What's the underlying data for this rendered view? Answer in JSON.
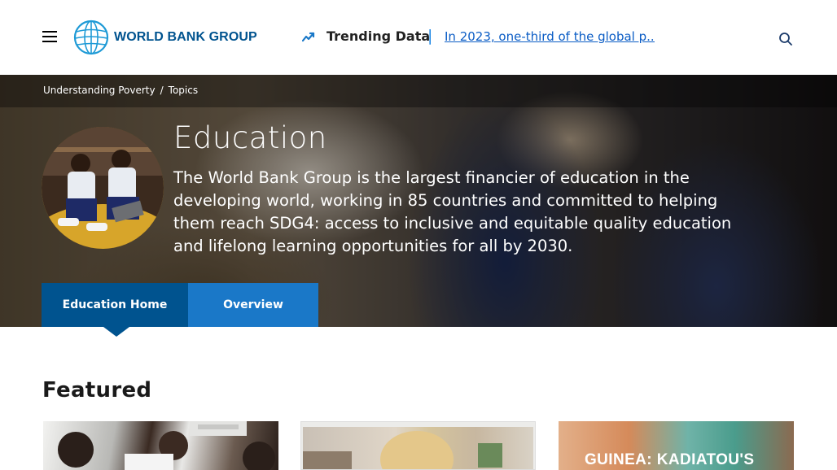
{
  "header": {
    "logo_text": "WORLD BANK GROUP",
    "trending_label": "Trending Data",
    "trending_link": "In 2023, one-third of the global p..."
  },
  "breadcrumb": {
    "items": [
      "Understanding Poverty",
      "Topics"
    ],
    "separator": "/"
  },
  "hero": {
    "title": "Education",
    "description": "The World Bank Group is the largest financier of education in the developing world, working in 85 countries and committed to helping them reach SDG4: access to inclusive and equitable quality education and lifelong learning opportunities for all by 2030."
  },
  "tabs": [
    {
      "label": "Education Home",
      "active": true
    },
    {
      "label": "Overview",
      "active": false
    }
  ],
  "featured": {
    "title": "Featured",
    "cards": [
      {
        "text": ""
      },
      {
        "text": ""
      },
      {
        "text": "GUINEA: KADIATOU'S"
      }
    ]
  },
  "colors": {
    "brand_blue": "#00538f",
    "tab_light_blue": "#1a78c8",
    "link_blue": "#0a5cc5"
  }
}
